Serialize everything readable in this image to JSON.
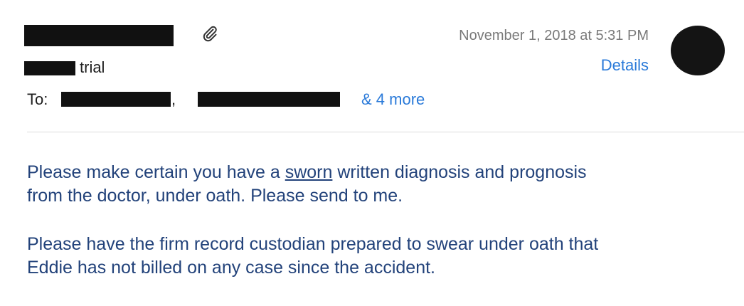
{
  "header": {
    "subject_suffix": "trial",
    "to_label": "To:",
    "to_separator": ",",
    "more_recipients": "& 4 more",
    "date": "November 1, 2018 at 5:31 PM",
    "details_label": "Details"
  },
  "message": {
    "p1_before": "Please make certain you have a ",
    "p1_underlined": "sworn",
    "p1_after_line1": " written diagnosis and prognosis",
    "p1_line2": "from the doctor, under oath.  Please send to me.",
    "p2_line1": "Please have the firm record custodian prepared to swear under oath that",
    "p2_line2": "Eddie has not billed on any case since the accident."
  },
  "icons": {
    "attachment": "paperclip-icon",
    "avatar": "avatar"
  },
  "colors": {
    "link": "#2a7ad9",
    "body_text": "#22427a",
    "meta_text": "#7a7a7a",
    "redaction": "#111111"
  }
}
